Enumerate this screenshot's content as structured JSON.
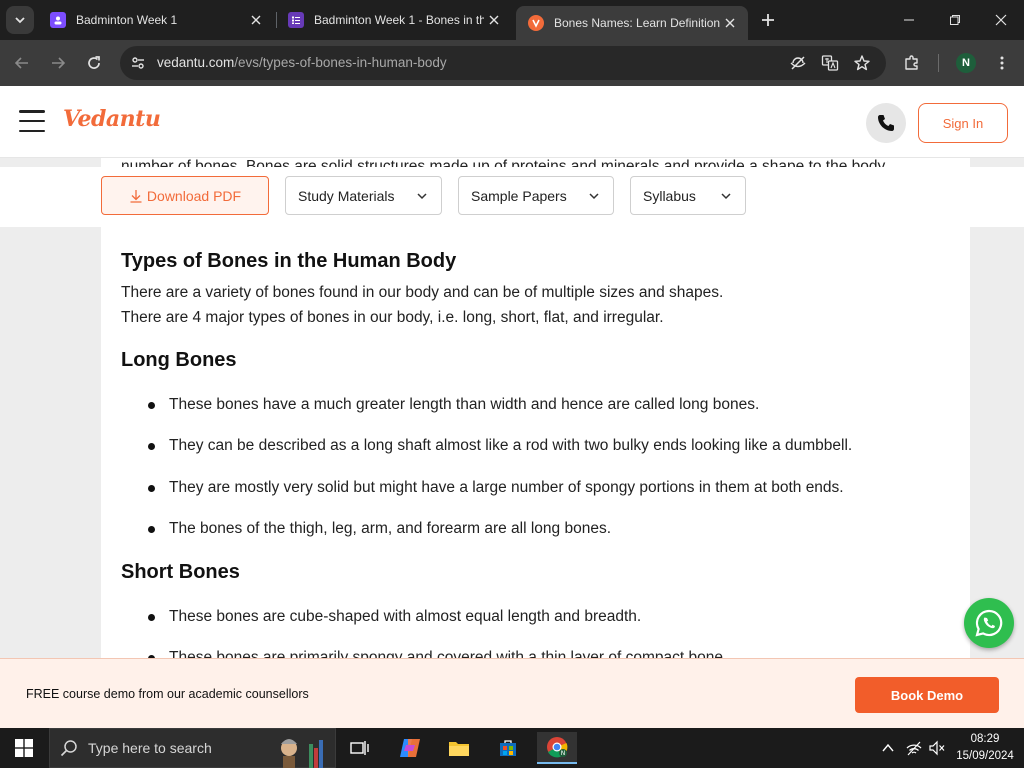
{
  "browser": {
    "tabs": [
      {
        "title": "Badminton Week 1",
        "favicon": "classroom-icon",
        "color": "#7c4dff"
      },
      {
        "title": "Badminton Week 1 - Bones in th",
        "favicon": "forms-icon",
        "color": "#673ab7"
      },
      {
        "title": "Bones Names: Learn Definition,",
        "favicon": "vedantu-icon",
        "color": "#f26b3a",
        "active": true
      }
    ],
    "url_domain": "vedantu.com",
    "url_path": "/evs/types-of-bones-in-human-body",
    "profile_initial": "N"
  },
  "site": {
    "logo": "Vedantu",
    "sign_in": "Sign In",
    "accent": "#f26b3a"
  },
  "sticky": {
    "download_pdf": "Download PDF",
    "study_materials": "Study Materials",
    "sample_papers": "Sample Papers",
    "syllabus": "Syllabus"
  },
  "article": {
    "cut_line": "number of bones. Bones are solid structures made up of proteins and minerals and provide a shape to the body.",
    "heading_types": "Types of Bones in the Human Body",
    "para1": "There are a  variety of bones found in our body and can be of multiple sizes and shapes.",
    "para2": "There are 4 major types of bones in our body, i.e. long, short, flat, and irregular.",
    "heading_long": "Long Bones",
    "long_items": [
      "These bones have a much greater length than width and hence are called long bones.",
      "They can be described as a  long shaft almost like a rod with two bulky ends looking like a dumbbell.",
      "They are mostly very solid but might have a large number of spongy portions in them at both ends.",
      "The bones of the thigh, leg, arm, and forearm are all long bones."
    ],
    "heading_short": "Short Bones",
    "short_items": [
      "These bones are cube-shaped with almost equal length and breadth.",
      "These bones are primarily spongy and covered with a thin layer of compact bone."
    ]
  },
  "banner": {
    "text": "FREE course demo from our academic counsellors",
    "button": "Book Demo"
  },
  "taskbar": {
    "search_placeholder": "Type here to search",
    "time": "08:29",
    "date": "15/09/2024"
  }
}
